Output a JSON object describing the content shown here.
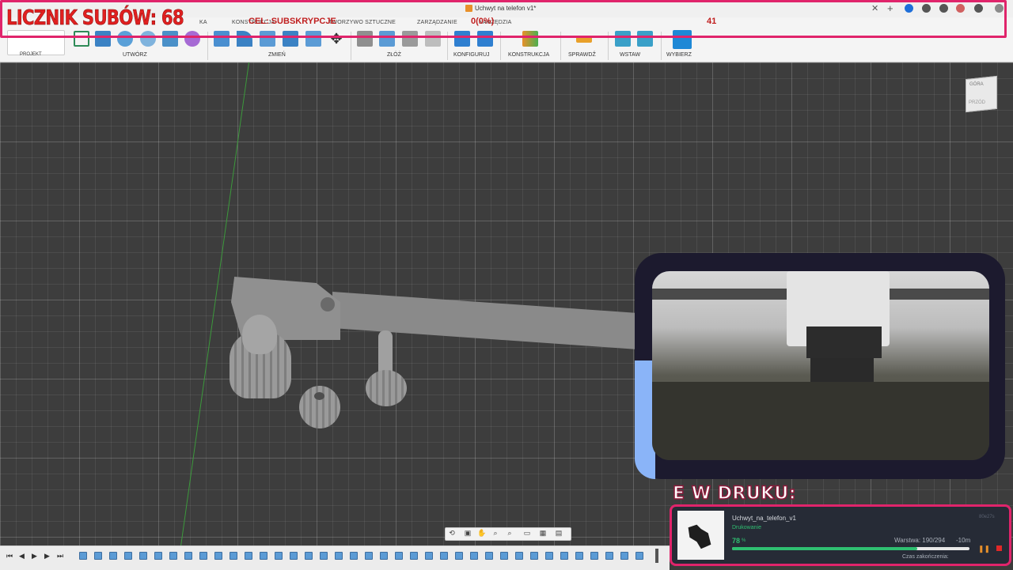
{
  "app": {
    "document_title": "Uchwyt na telefon v1*"
  },
  "toolbar": {
    "tabs": [
      "KONSTRUKCJA",
      "TWORZYWO SZTUCZNE",
      "ZARZĄDZANIE",
      "NARZĘDZIA"
    ],
    "tab_fragment_left": "KA",
    "project_label": "PROJEKT",
    "groups": [
      "UTWÓRZ",
      "ZMIEŃ",
      "ZŁÓŻ",
      "KONFIGURUJ",
      "KONSTRUKCJA",
      "SPRAWDŹ",
      "WSTAW",
      "WYBIERZ"
    ],
    "icons": [
      "sketch-icon",
      "box-icon",
      "revolve-icon",
      "hole-icon",
      "pattern-icon",
      "form-icon",
      "press-pull-icon",
      "fillet-icon",
      "shell-icon",
      "combine-icon",
      "scale-icon",
      "move-icon",
      "joint-icon",
      "new-component-icon",
      "as-built-joint-icon",
      "rigid-group-icon",
      "parameters-icon",
      "configure-icon",
      "offset-plane-icon",
      "measure-icon",
      "insert-mesh-icon",
      "insert-canvas-icon",
      "select-icon"
    ]
  },
  "overlay": {
    "subscriber_counter": "LICZNIK SUBÓW: 68",
    "goal_label": "CEL: SUBSKRYPCJE",
    "goal_progress": "0(0%)",
    "goal_target": "41",
    "colors": {
      "frame": "#e0246b",
      "counter_text": "#e02020",
      "camera_bg": "#1c1a2e",
      "accent_blue": "#8ab4f8"
    }
  },
  "viewcube": {
    "top": "GÓRA",
    "front": "PRZÓD"
  },
  "print": {
    "heading": "E W DRUKU:",
    "job_name": "Uchwyt_na_telefon_v1",
    "status": "Drukowanie",
    "percent": "78",
    "percent_sign": "%",
    "progress": 0.78,
    "layer": "Warstwa: 190/294",
    "remaining": "-10m",
    "eta_label": "Czas zakończenia:",
    "job_id": "80e27s"
  },
  "navbar": {
    "icons": [
      "orbit-icon",
      "look-at-icon",
      "pan-icon",
      "zoom-icon",
      "fit-icon",
      "display-icon",
      "grid-icon",
      "viewports-icon"
    ]
  },
  "timeline": {
    "controls": [
      "go-to-start-icon",
      "step-back-icon",
      "play-icon",
      "step-forward-icon",
      "go-to-end-icon"
    ],
    "item_count": 38
  }
}
